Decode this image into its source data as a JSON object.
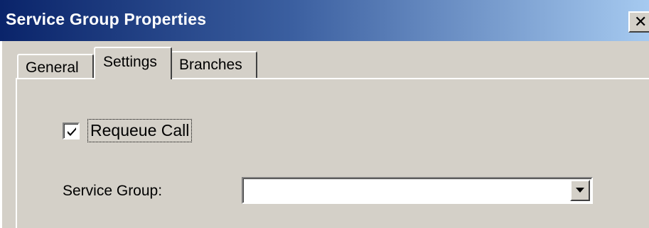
{
  "window": {
    "title": "Service Group Properties",
    "close_glyph": "✕"
  },
  "tabs": [
    {
      "label": "General",
      "active": false
    },
    {
      "label": "Settings",
      "active": true
    },
    {
      "label": "Branches",
      "active": false
    }
  ],
  "settings": {
    "requeue_call": {
      "label": "Requeue Call",
      "checked": true
    },
    "service_group": {
      "label": "Service Group:",
      "value": ""
    }
  },
  "icons": {
    "close": "close-icon",
    "check": "checkmark-icon",
    "dropdown": "chevron-down-icon"
  },
  "colors": {
    "title_gradient_start": "#0a246a",
    "title_gradient_end": "#a6caf0",
    "face": "#d4d0c8"
  }
}
